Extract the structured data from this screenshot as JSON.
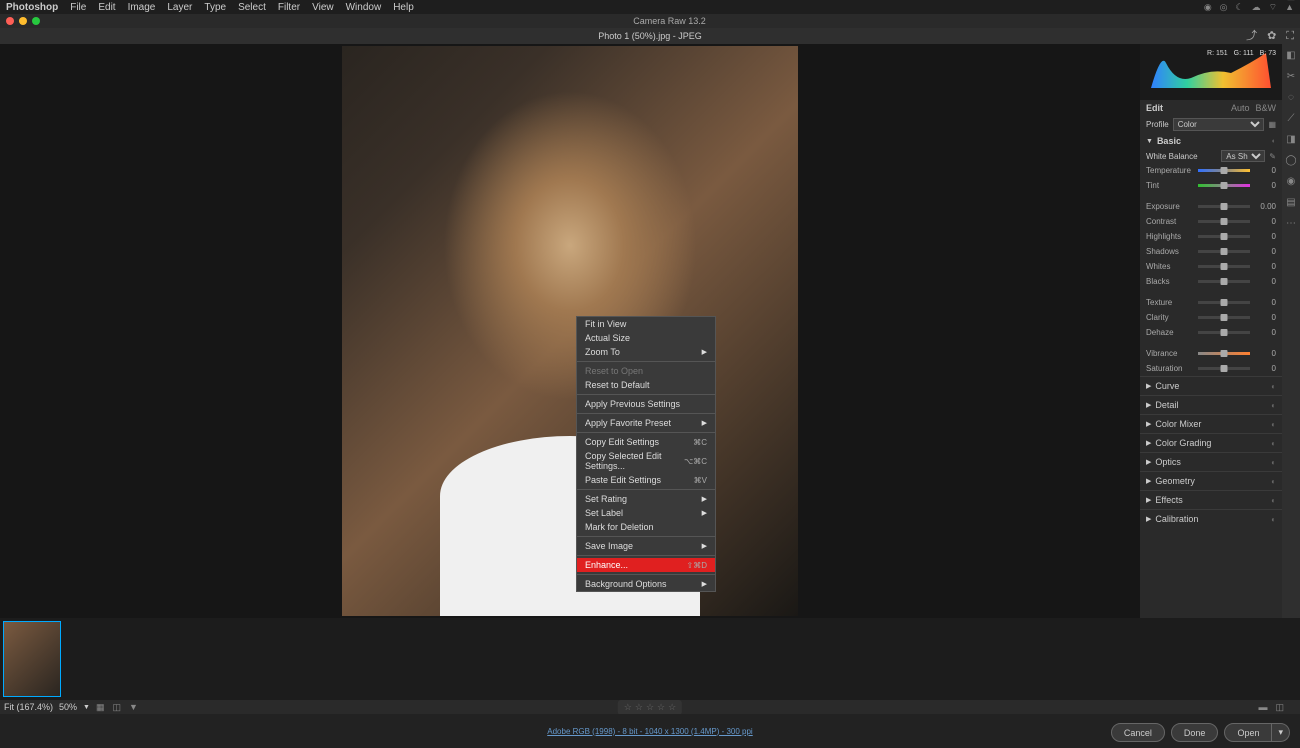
{
  "menubar": {
    "app": "Photoshop",
    "items": [
      "File",
      "Edit",
      "Image",
      "Layer",
      "Type",
      "Select",
      "Filter",
      "View",
      "Window",
      "Help"
    ]
  },
  "window": {
    "title": "Camera Raw 13.2"
  },
  "document": {
    "title": "Photo 1 (50%).jpg  -  JPEG"
  },
  "histogram": {
    "r": "R: 151",
    "g": "G: 111",
    "b": "B: 73"
  },
  "edit": {
    "label": "Edit",
    "auto": "Auto",
    "bw": "B&W",
    "profile_label": "Profile",
    "profile_value": "Color"
  },
  "basic": {
    "label": "Basic",
    "wb_label": "White Balance",
    "wb_value": "As Shot",
    "sliders1": [
      {
        "label": "Temperature",
        "value": "0",
        "cls": "temp"
      },
      {
        "label": "Tint",
        "value": "0",
        "cls": "tint"
      }
    ],
    "sliders2": [
      {
        "label": "Exposure",
        "value": "0.00"
      },
      {
        "label": "Contrast",
        "value": "0"
      },
      {
        "label": "Highlights",
        "value": "0"
      },
      {
        "label": "Shadows",
        "value": "0"
      },
      {
        "label": "Whites",
        "value": "0"
      },
      {
        "label": "Blacks",
        "value": "0"
      }
    ],
    "sliders3": [
      {
        "label": "Texture",
        "value": "0"
      },
      {
        "label": "Clarity",
        "value": "0"
      },
      {
        "label": "Dehaze",
        "value": "0"
      }
    ],
    "sliders4": [
      {
        "label": "Vibrance",
        "value": "0",
        "cls": "vib"
      },
      {
        "label": "Saturation",
        "value": "0"
      }
    ]
  },
  "panels": [
    "Curve",
    "Detail",
    "Color Mixer",
    "Color Grading",
    "Optics",
    "Geometry",
    "Effects",
    "Calibration"
  ],
  "contextmenu": {
    "groups": [
      [
        {
          "label": "Fit in View"
        },
        {
          "label": "Actual Size"
        },
        {
          "label": "Zoom To",
          "submenu": true
        }
      ],
      [
        {
          "label": "Reset to Open",
          "disabled": true
        },
        {
          "label": "Reset to Default"
        }
      ],
      [
        {
          "label": "Apply Previous Settings"
        }
      ],
      [
        {
          "label": "Apply Favorite Preset",
          "submenu": true
        }
      ],
      [
        {
          "label": "Copy Edit Settings",
          "shortcut": "⌘C"
        },
        {
          "label": "Copy Selected Edit Settings...",
          "shortcut": "⌥⌘C"
        },
        {
          "label": "Paste Edit Settings",
          "shortcut": "⌘V"
        }
      ],
      [
        {
          "label": "Set Rating",
          "submenu": true
        },
        {
          "label": "Set Label",
          "submenu": true
        },
        {
          "label": "Mark for Deletion"
        }
      ],
      [
        {
          "label": "Save Image",
          "submenu": true
        }
      ],
      [
        {
          "label": "Enhance...",
          "shortcut": "⇧⌘D",
          "highlight": true
        }
      ],
      [
        {
          "label": "Background Options",
          "submenu": true
        }
      ]
    ]
  },
  "status": {
    "fit": "Fit (167.4%)",
    "zoom": "50%"
  },
  "footer": {
    "meta": "Adobe RGB (1998) - 8 bit - 1040 x 1300 (1.4MP) - 300 ppi",
    "cancel": "Cancel",
    "done": "Done",
    "open": "Open"
  }
}
